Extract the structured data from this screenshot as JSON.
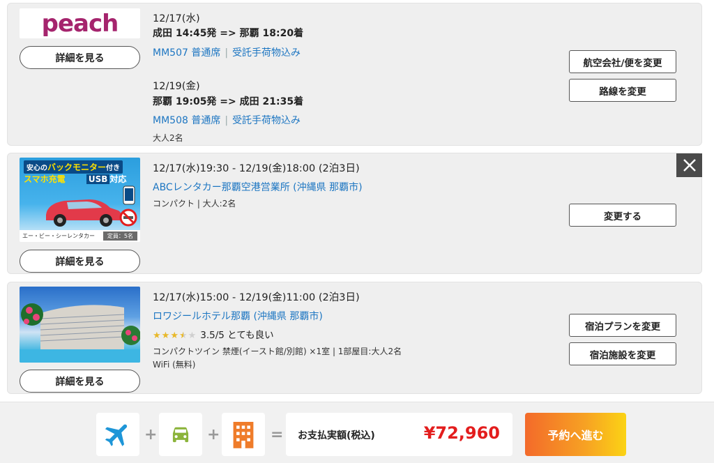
{
  "flight": {
    "airline_logo": "peach",
    "detail_button": "詳細を見る",
    "outbound": {
      "date": "12/17(水)",
      "route": "成田 14:45発 => 那覇 18:20着",
      "flight_no": "MM507 普通席",
      "baggage": "受託手荷物込み"
    },
    "return": {
      "date": "12/19(金)",
      "route": "那覇 19:05発 => 成田 21:35着",
      "flight_no": "MM508 普通席",
      "baggage": "受託手荷物込み"
    },
    "pax": "大人2名",
    "change_airline_button": "航空会社/便を変更",
    "change_route_button": "路線を変更"
  },
  "rental": {
    "banner": {
      "top_line_a": "安心の",
      "top_line_b": "バックモニター",
      "top_line_c": "付き",
      "second_line_a": "スマホ充電",
      "second_line_b": "USB",
      "second_line_c": "対応",
      "brand": "エー・ビー・シーレンタカー",
      "capacity": "定員：5名"
    },
    "detail_button": "詳細を見る",
    "period": "12/17(水)19:30 - 12/19(金)18:00 (2泊3日)",
    "office": "ABCレンタカー那覇空港営業所 (沖縄県 那覇市)",
    "spec": "コンパクト | 大人:2名",
    "change_button": "変更する",
    "close_label": "×"
  },
  "hotel": {
    "detail_button": "詳細を見る",
    "period": "12/17(水)15:00 - 12/19(金)11:00 (2泊3日)",
    "name": "ロワジールホテル那覇 (沖縄県 那覇市)",
    "rating": 3.5,
    "rating_text": "3.5/5 とても良い",
    "room": "コンパクトツイン 禁煙(イースト館/別館) ×1室 | 1部屋目:大人2名",
    "wifi": "WiFi (無料)",
    "change_plan_button": "宿泊プランを変更",
    "change_hotel_button": "宿泊施設を変更"
  },
  "footer": {
    "plus": "+",
    "equals": "=",
    "total_label": "お支払実額(税込)",
    "total_price": "¥72,960",
    "proceed_button": "予約へ進む",
    "colors": {
      "plane": "#1e96d8",
      "car": "#8cb43c",
      "hotel": "#ef7c2a",
      "price": "#e31d1d"
    }
  }
}
